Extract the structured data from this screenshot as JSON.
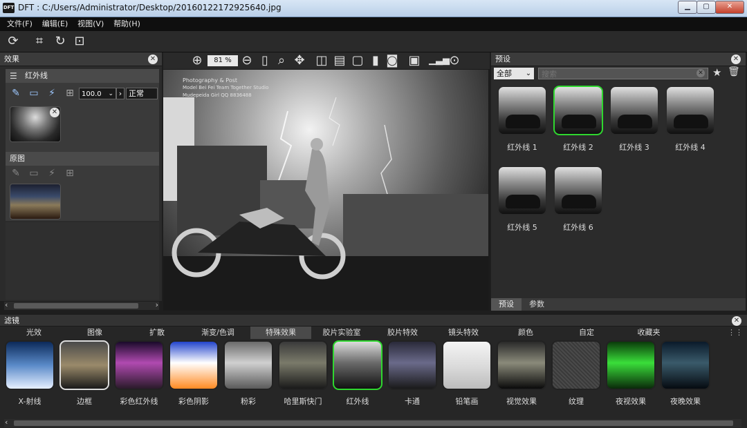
{
  "window": {
    "title": "DFT : C:/Users/Administrator/Desktop/20160122172925640.jpg",
    "app_icon": "DFT"
  },
  "menu": [
    {
      "label": "文件(F)"
    },
    {
      "label": "编辑(E)"
    },
    {
      "label": "视图(V)"
    },
    {
      "label": "帮助(H)"
    }
  ],
  "effects_panel": {
    "title": "效果",
    "layer_name": "红外线",
    "opacity_value": "100.0",
    "blend_mode": "正常",
    "original_title": "原图"
  },
  "viewer": {
    "zoom": "81 %"
  },
  "watermark": {
    "line1": "Photography & Post",
    "line2": "Model Bei Fei  Team Together  Studio",
    "line3": "Mudepeida  Girl     QQ 8836488"
  },
  "presets_panel": {
    "title": "预设",
    "category": "全部",
    "search_placeholder": "搜索",
    "items": [
      {
        "label": "红外线 1"
      },
      {
        "label": "红外线 2"
      },
      {
        "label": "红外线 3"
      },
      {
        "label": "红外线 4"
      },
      {
        "label": "红外线 5"
      },
      {
        "label": "红外线 6"
      }
    ],
    "bottom_tabs": [
      {
        "label": "预设"
      },
      {
        "label": "参数"
      }
    ]
  },
  "filters_panel": {
    "title": "滤镜",
    "tabs": [
      {
        "label": "光效"
      },
      {
        "label": "图像"
      },
      {
        "label": "扩散"
      },
      {
        "label": "渐变/色调"
      },
      {
        "label": "特殊效果"
      },
      {
        "label": "胶片实验室"
      },
      {
        "label": "胶片特效"
      },
      {
        "label": "镜头特效"
      },
      {
        "label": "颜色"
      },
      {
        "label": "自定"
      },
      {
        "label": "收藏夹"
      }
    ],
    "items": [
      {
        "label": "X-射线"
      },
      {
        "label": "边框"
      },
      {
        "label": "彩色红外线"
      },
      {
        "label": "彩色阴影"
      },
      {
        "label": "粉彩"
      },
      {
        "label": "哈里斯快门"
      },
      {
        "label": "红外线"
      },
      {
        "label": "卡通"
      },
      {
        "label": "铅笔画"
      },
      {
        "label": "视觉效果"
      },
      {
        "label": "纹理"
      },
      {
        "label": "夜视效果"
      },
      {
        "label": "夜晚效果"
      }
    ]
  },
  "colors": {
    "selection_accent": "#2fd82f",
    "panel_bg": "#2b2b2b"
  }
}
